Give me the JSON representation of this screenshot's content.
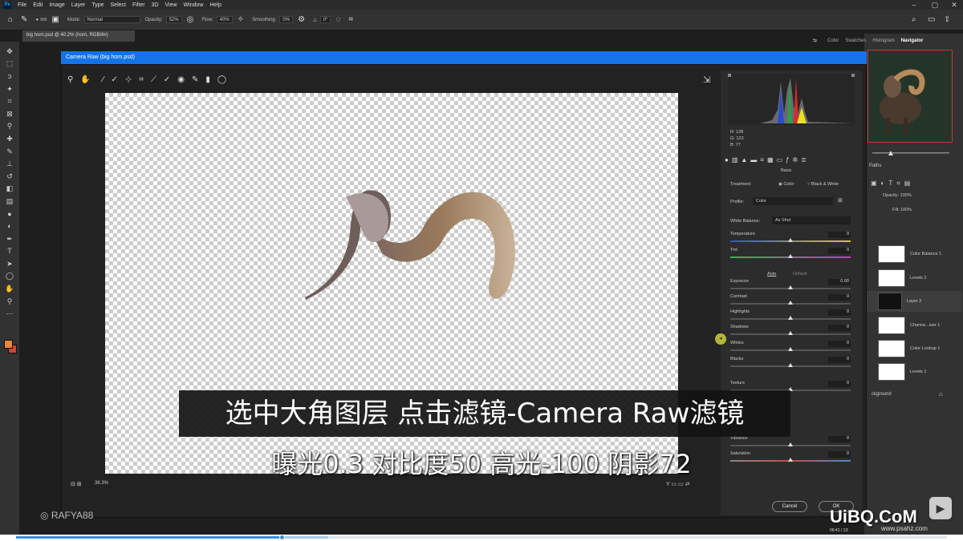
{
  "app": {
    "logo": "Ps",
    "menu": [
      "File",
      "Edit",
      "Image",
      "Layer",
      "Type",
      "Select",
      "Filter",
      "3D",
      "View",
      "Window",
      "Help"
    ]
  },
  "options": {
    "brush_size": "900",
    "mode_label": "Mode:",
    "mode_value": "Normal",
    "opacity_label": "Opacity:",
    "opacity_value": "52%",
    "flow_label": "Flow:",
    "flow_value": "40%",
    "smoothing_label": "Smoothing:",
    "smoothing_value": "0%",
    "angle_value": "0°"
  },
  "document_tab": "big horn.psd @ 40.2% (horn, RGB/8#)",
  "right_tabs": [
    "Color",
    "Swatches",
    "Histogram",
    "Navigator"
  ],
  "layers": {
    "tabs_label": "Paths",
    "opacity_label": "Opacity:",
    "opacity_value": "100%",
    "fill_label": "Fill:",
    "fill_value": "100%",
    "items": [
      {
        "name": "Color Balance 1"
      },
      {
        "name": "Levels 2"
      },
      {
        "name": "Layer 2"
      },
      {
        "name": "Channe...ixer 1"
      },
      {
        "name": "Color Lookup 1"
      },
      {
        "name": "Levels 1"
      }
    ],
    "background_label": "ckground"
  },
  "camera_raw": {
    "title": "Camera Raw (big horn.psd)",
    "rgb": {
      "r": "R: 128",
      "g": "G: 123",
      "b": "B: 77"
    },
    "panel_title": "Basic",
    "treatment_label": "Treatment:",
    "treatment_color": "Color",
    "treatment_bw": "Black & White",
    "profile_label": "Profile:",
    "profile_value": "Color",
    "wb_label": "White Balance:",
    "wb_value": "As Shot",
    "auto_label": "Auto",
    "default_label": "Default",
    "sliders": [
      {
        "label": "Temperature",
        "value": "0",
        "level": 0.5
      },
      {
        "label": "Tint",
        "value": "0",
        "level": 0.5
      },
      {
        "label": "Exposure",
        "value": "0.00",
        "level": 0.5
      },
      {
        "label": "Contrast",
        "value": "0",
        "level": 0.5
      },
      {
        "label": "Highlights",
        "value": "0",
        "level": 0.5
      },
      {
        "label": "Shadows",
        "value": "0",
        "level": 0.5
      },
      {
        "label": "Whites",
        "value": "0",
        "level": 0.5
      },
      {
        "label": "Blacks",
        "value": "0",
        "level": 0.5
      },
      {
        "label": "Texture",
        "value": "0",
        "level": 0.5
      },
      {
        "label": "Vibrance",
        "value": "0",
        "level": 0.5
      },
      {
        "label": "Saturation",
        "value": "0",
        "level": 0.5
      }
    ],
    "zoom": "36.3%",
    "cancel_label": "Cancel",
    "ok_label": "OK"
  },
  "subtitles": {
    "line1": "选中大角图层 点击滤镜-Camera Raw滤镜",
    "line2": "曝光0.3 对比度50 高光-100 阴影72"
  },
  "watermark": "RAFYA88",
  "site": {
    "logo": "UiBQ.CoM",
    "url": "www.psahz.com"
  },
  "video": {
    "progress": 0.285,
    "buffered": 0.335,
    "time": "06:41 / 13:"
  }
}
